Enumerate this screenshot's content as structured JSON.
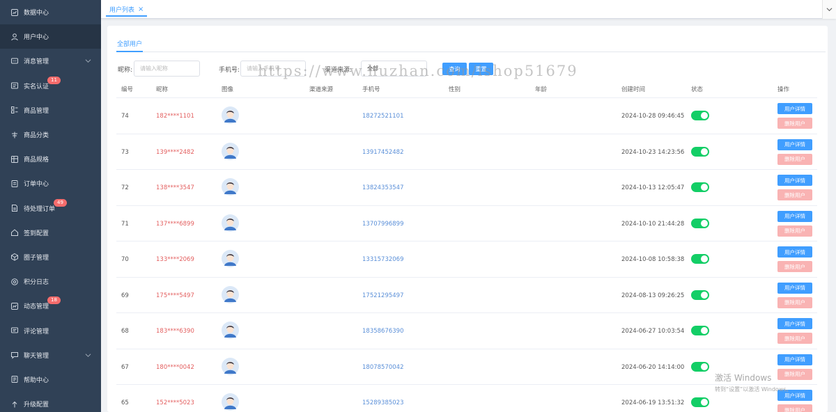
{
  "sidebar": {
    "items": [
      {
        "label": "数据中心",
        "icon": "chart-box-icon",
        "badge": "",
        "chevron": false,
        "active": false
      },
      {
        "label": "用户中心",
        "icon": "user-icon",
        "badge": "",
        "chevron": false,
        "active": true
      },
      {
        "label": "消息管理",
        "icon": "message-icon",
        "badge": "",
        "chevron": true,
        "active": false
      },
      {
        "label": "实名认证",
        "icon": "id-card-icon",
        "badge": "11",
        "chevron": false,
        "active": false
      },
      {
        "label": "商品管理",
        "icon": "grid-list-icon",
        "badge": "",
        "chevron": false,
        "active": false
      },
      {
        "label": "商品分类",
        "icon": "category-icon",
        "badge": "",
        "chevron": false,
        "active": false
      },
      {
        "label": "商品规格",
        "icon": "table-icon",
        "badge": "",
        "chevron": false,
        "active": false
      },
      {
        "label": "订单中心",
        "icon": "order-icon",
        "badge": "",
        "chevron": false,
        "active": false
      },
      {
        "label": "待处理订单",
        "icon": "document-icon",
        "badge": "49",
        "chevron": false,
        "active": false
      },
      {
        "label": "签到配置",
        "icon": "home-icon",
        "badge": "",
        "chevron": false,
        "active": false
      },
      {
        "label": "圈子管理",
        "icon": "cube-icon",
        "badge": "",
        "chevron": false,
        "active": false
      },
      {
        "label": "积分日志",
        "icon": "settings-circle-icon",
        "badge": "",
        "chevron": false,
        "active": false
      },
      {
        "label": "动态管理",
        "icon": "chart-line-icon",
        "badge": "18",
        "chevron": false,
        "active": false
      },
      {
        "label": "评论管理",
        "icon": "comment-icon",
        "badge": "",
        "chevron": false,
        "active": false
      },
      {
        "label": "聊天管理",
        "icon": "chat-icon",
        "badge": "",
        "chevron": true,
        "active": false
      },
      {
        "label": "帮助中心",
        "icon": "help-icon",
        "badge": "",
        "chevron": false,
        "active": false
      },
      {
        "label": "升级配置",
        "icon": "upgrade-icon",
        "badge": "",
        "chevron": false,
        "active": false
      }
    ]
  },
  "tagsbar": {
    "active_tag": "用户列表",
    "close_symbol": "×"
  },
  "tabs": {
    "active": "全部用户"
  },
  "filter": {
    "nickname_label": "昵称:",
    "nickname_placeholder": "请输入昵称",
    "phone_label": "手机号:",
    "phone_placeholder": "请输入手机号",
    "channel_label": "渠道来源:",
    "channel_value": "全部",
    "search_button": "查询",
    "reset_button": "重置"
  },
  "table": {
    "headers": [
      "编号",
      "昵称",
      "图像",
      "渠道来源",
      "手机号",
      "性别",
      "年龄",
      "创建时间",
      "状态",
      "操作"
    ],
    "detail_button": "用户详情",
    "delete_button": "删除用户",
    "rows": [
      {
        "id": "74",
        "nickname": "182****1101",
        "phone": "18272521101",
        "created": "2024-10-28 09:46:45",
        "status_on": true
      },
      {
        "id": "73",
        "nickname": "139****2482",
        "phone": "13917452482",
        "created": "2024-10-23 14:23:56",
        "status_on": true
      },
      {
        "id": "72",
        "nickname": "138****3547",
        "phone": "13824353547",
        "created": "2024-10-13 12:05:47",
        "status_on": true
      },
      {
        "id": "71",
        "nickname": "137****6899",
        "phone": "13707996899",
        "created": "2024-10-10 21:44:28",
        "status_on": true
      },
      {
        "id": "70",
        "nickname": "133****2069",
        "phone": "13315732069",
        "created": "2024-10-08 10:58:38",
        "status_on": true
      },
      {
        "id": "69",
        "nickname": "175****5497",
        "phone": "17521295497",
        "created": "2024-08-13 09:26:25",
        "status_on": true
      },
      {
        "id": "68",
        "nickname": "183****6390",
        "phone": "18358676390",
        "created": "2024-06-27 10:03:54",
        "status_on": true
      },
      {
        "id": "67",
        "nickname": "180****0042",
        "phone": "18078570042",
        "created": "2024-06-20 14:14:00",
        "status_on": true
      },
      {
        "id": "65",
        "nickname": "152****5023",
        "phone": "15289385023",
        "created": "2024-06-19 13:51:32",
        "status_on": true
      }
    ]
  },
  "watermark": {
    "text": "https://www.huzhan.com/ishop51679"
  },
  "activation": {
    "line1": "激活 Windows",
    "line2": "转到“设置”以激活 Windows。"
  },
  "colors": {
    "sidebar_bg": "#304156",
    "primary": "#409eff",
    "switch_on": "#13ce66",
    "nickname": "#e35f5f",
    "phone": "#5a8fd8",
    "delete_btn": "#f9b3b3"
  }
}
